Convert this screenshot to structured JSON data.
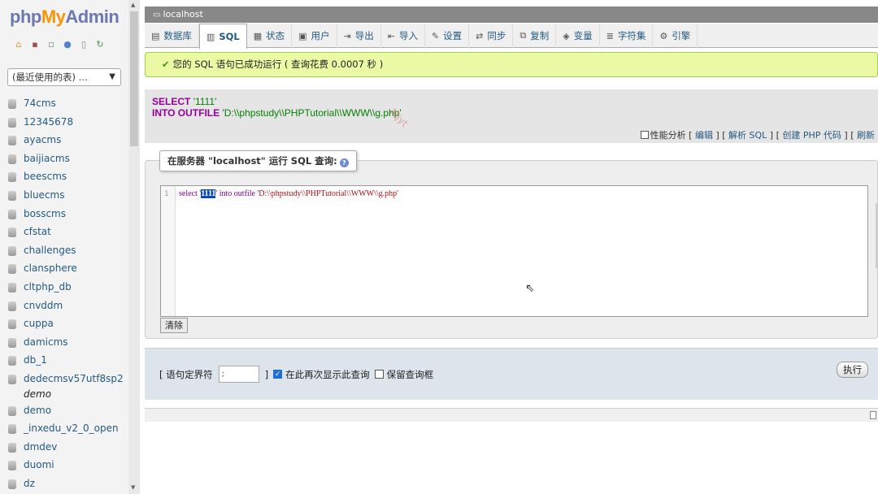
{
  "logo": {
    "php": "php",
    "my": "My",
    "admin": "Admin"
  },
  "nav": {
    "recent": "(最近使用的表) ...",
    "databases": [
      "74cms",
      "12345678",
      "ayacms",
      "baijiacms",
      "beescms",
      "bluecms",
      "bosscms",
      "cfstat",
      "challenges",
      "clansphere",
      "cltphp_db",
      "cnvddm",
      "cuppa",
      "damicms",
      "db_1",
      "dedecmsv57utf8sp2"
    ],
    "sub_item": "demo",
    "databases2": [
      "demo",
      "_inxedu_v2_0_open",
      "dmdev",
      "duomi",
      "dz"
    ]
  },
  "server": {
    "title": "localhost"
  },
  "menu": {
    "tabs": [
      {
        "icon": "▤",
        "label": "数据库"
      },
      {
        "icon": "▥",
        "label": "SQL"
      },
      {
        "icon": "▦",
        "label": "状态"
      },
      {
        "icon": "▣",
        "label": "用户"
      },
      {
        "icon": "⇥",
        "label": "导出"
      },
      {
        "icon": "⇤",
        "label": "导入"
      },
      {
        "icon": "✎",
        "label": "设置"
      },
      {
        "icon": "⇄",
        "label": "同步"
      },
      {
        "icon": "⧉",
        "label": "复制"
      },
      {
        "icon": "◈",
        "label": "变量"
      },
      {
        "icon": "≣",
        "label": "字符集"
      },
      {
        "icon": "⚙",
        "label": "引擎"
      }
    ]
  },
  "message": {
    "success": "您的 SQL 语句已成功运行 ( 查询花费 0.0007 秒 )"
  },
  "sql_echo": {
    "select_kw": "SELECT",
    "select_val": "'1111'",
    "into_kw": "INTO OUTFILE",
    "into_val": "'D:\\\\phpstudy\\\\PHPTutorial\\\\WWW\\\\g.php'",
    "watermark": "Mjyt",
    "profile": "性能分析",
    "edit": "编辑",
    "parse": "解析 SQL",
    "create_php": "创建 PHP 代码",
    "refresh": "刷新"
  },
  "query": {
    "legend": "在服务器 \"localhost\" 运行 SQL 查询:",
    "line_no": "1",
    "code_select": "select ",
    "code_q1": "'",
    "code_sel": "1111",
    "code_q2": "'",
    "code_into": " into outfile ",
    "code_path": "'D:\\\\phpstudy\\\\PHPTutorial\\\\WWW\\\\g.php'",
    "clear": "清除"
  },
  "options": {
    "delim_label_open": "[ 语句定界符",
    "delim_value": ";",
    "delim_label_close": "]",
    "show_again": "在此再次显示此查询",
    "keep_box": "保留查询框",
    "go": "执行"
  }
}
